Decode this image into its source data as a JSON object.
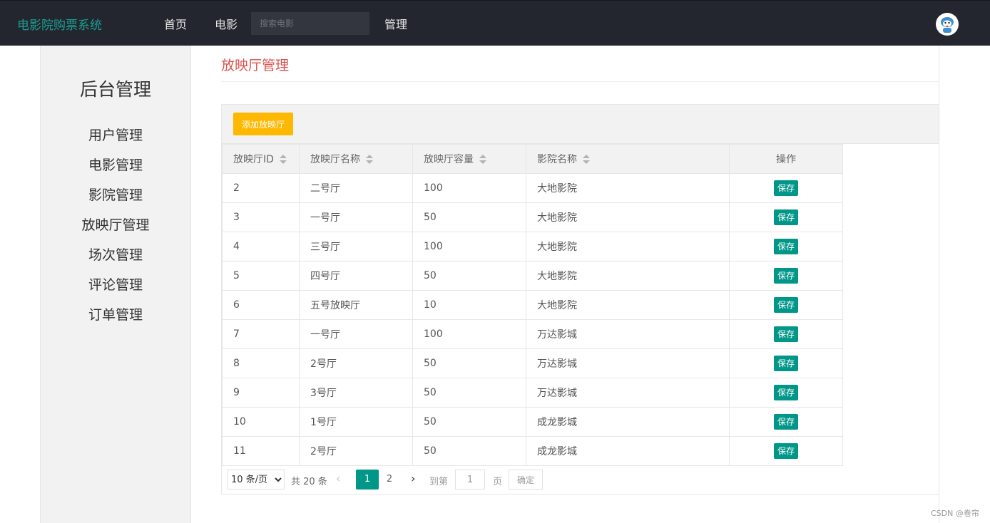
{
  "header": {
    "brand": "电影院购票系统",
    "nav": [
      "首页",
      "电影"
    ],
    "search_placeholder": "搜索电影",
    "manage": "管理",
    "avatar_icon": "robot-avatar-icon"
  },
  "sidebar": {
    "title": "后台管理",
    "items": [
      "用户管理",
      "电影管理",
      "影院管理",
      "放映厅管理",
      "场次管理",
      "评论管理",
      "订单管理"
    ]
  },
  "main": {
    "title": "放映厅管理",
    "add_button": "添加放映厅",
    "columns": [
      "放映厅ID",
      "放映厅名称",
      "放映厅容量",
      "影院名称",
      "操作"
    ],
    "save_label": "保存",
    "rows": [
      [
        "2",
        "二号厅",
        "100",
        "大地影院"
      ],
      [
        "3",
        "一号厅",
        "50",
        "大地影院"
      ],
      [
        "4",
        "三号厅",
        "100",
        "大地影院"
      ],
      [
        "5",
        "四号厅",
        "50",
        "大地影院"
      ],
      [
        "6",
        "五号放映厅",
        "10",
        "大地影院"
      ],
      [
        "7",
        "一号厅",
        "100",
        "万达影城"
      ],
      [
        "8",
        "2号厅",
        "50",
        "万达影城"
      ],
      [
        "9",
        "3号厅",
        "50",
        "万达影城"
      ],
      [
        "10",
        "1号厅",
        "50",
        "成龙影城"
      ],
      [
        "11",
        "2号厅",
        "50",
        "成龙影城"
      ]
    ]
  },
  "pagination": {
    "page_size": "10 条/页",
    "total": "共 20 条",
    "pages": [
      "1",
      "2"
    ],
    "goto_prefix": "到第",
    "goto_value": "1",
    "goto_suffix": "页",
    "confirm": "确定"
  },
  "watermark": "CSDN @卷帘",
  "colors": {
    "topbar": "#23262e",
    "brand": "#1aa094",
    "accent": "#009688",
    "warning": "#ffb800",
    "title": "#d9534f"
  }
}
